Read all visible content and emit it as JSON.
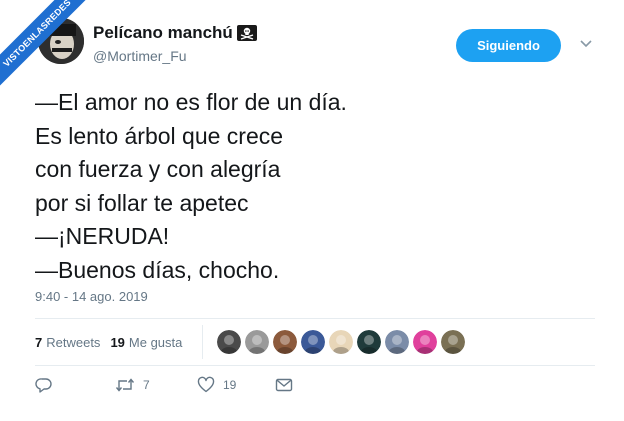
{
  "watermark": {
    "text": "VISTOENLASREDES",
    "color": "#1f6fd1"
  },
  "user": {
    "display_name": "Pelícano manchú",
    "name_emoji": "skull-and-crossbones-flag-icon",
    "handle": "@Mortimer_Fu"
  },
  "follow_button": {
    "label": "Siguiendo",
    "color": "#1da1f2"
  },
  "menu": {
    "icon": "chevron-down-icon"
  },
  "tweet": {
    "lines": [
      "—El amor no es flor de un día.",
      "Es lento árbol que crece",
      "con fuerza y con alegría",
      "por si follar te apetec",
      "—¡NERUDA!",
      "—Buenos días, chocho."
    ],
    "timestamp": "9:40 - 14 ago. 2019"
  },
  "stats": {
    "retweets_count": "7",
    "retweets_label": "Retweets",
    "likes_count": "19",
    "likes_label": "Me gusta"
  },
  "likers": [
    {
      "name": "liker-avatar-1",
      "color": "#4a4a4a"
    },
    {
      "name": "liker-avatar-2",
      "color": "#9a9a9a"
    },
    {
      "name": "liker-avatar-3",
      "color": "#8c5a3c"
    },
    {
      "name": "liker-avatar-4",
      "color": "#3b5998"
    },
    {
      "name": "liker-avatar-5",
      "color": "#e8d6b8"
    },
    {
      "name": "liker-avatar-6",
      "color": "#1f3b3b"
    },
    {
      "name": "liker-avatar-7",
      "color": "#7b8ca8"
    },
    {
      "name": "liker-avatar-8",
      "color": "#e0409c"
    },
    {
      "name": "liker-avatar-9",
      "color": "#7a7054"
    }
  ],
  "actions": {
    "reply_icon": "reply-icon",
    "retweet_icon": "retweet-icon",
    "retweet_count": "7",
    "like_icon": "heart-icon",
    "like_count": "19",
    "dm_icon": "envelope-icon"
  }
}
